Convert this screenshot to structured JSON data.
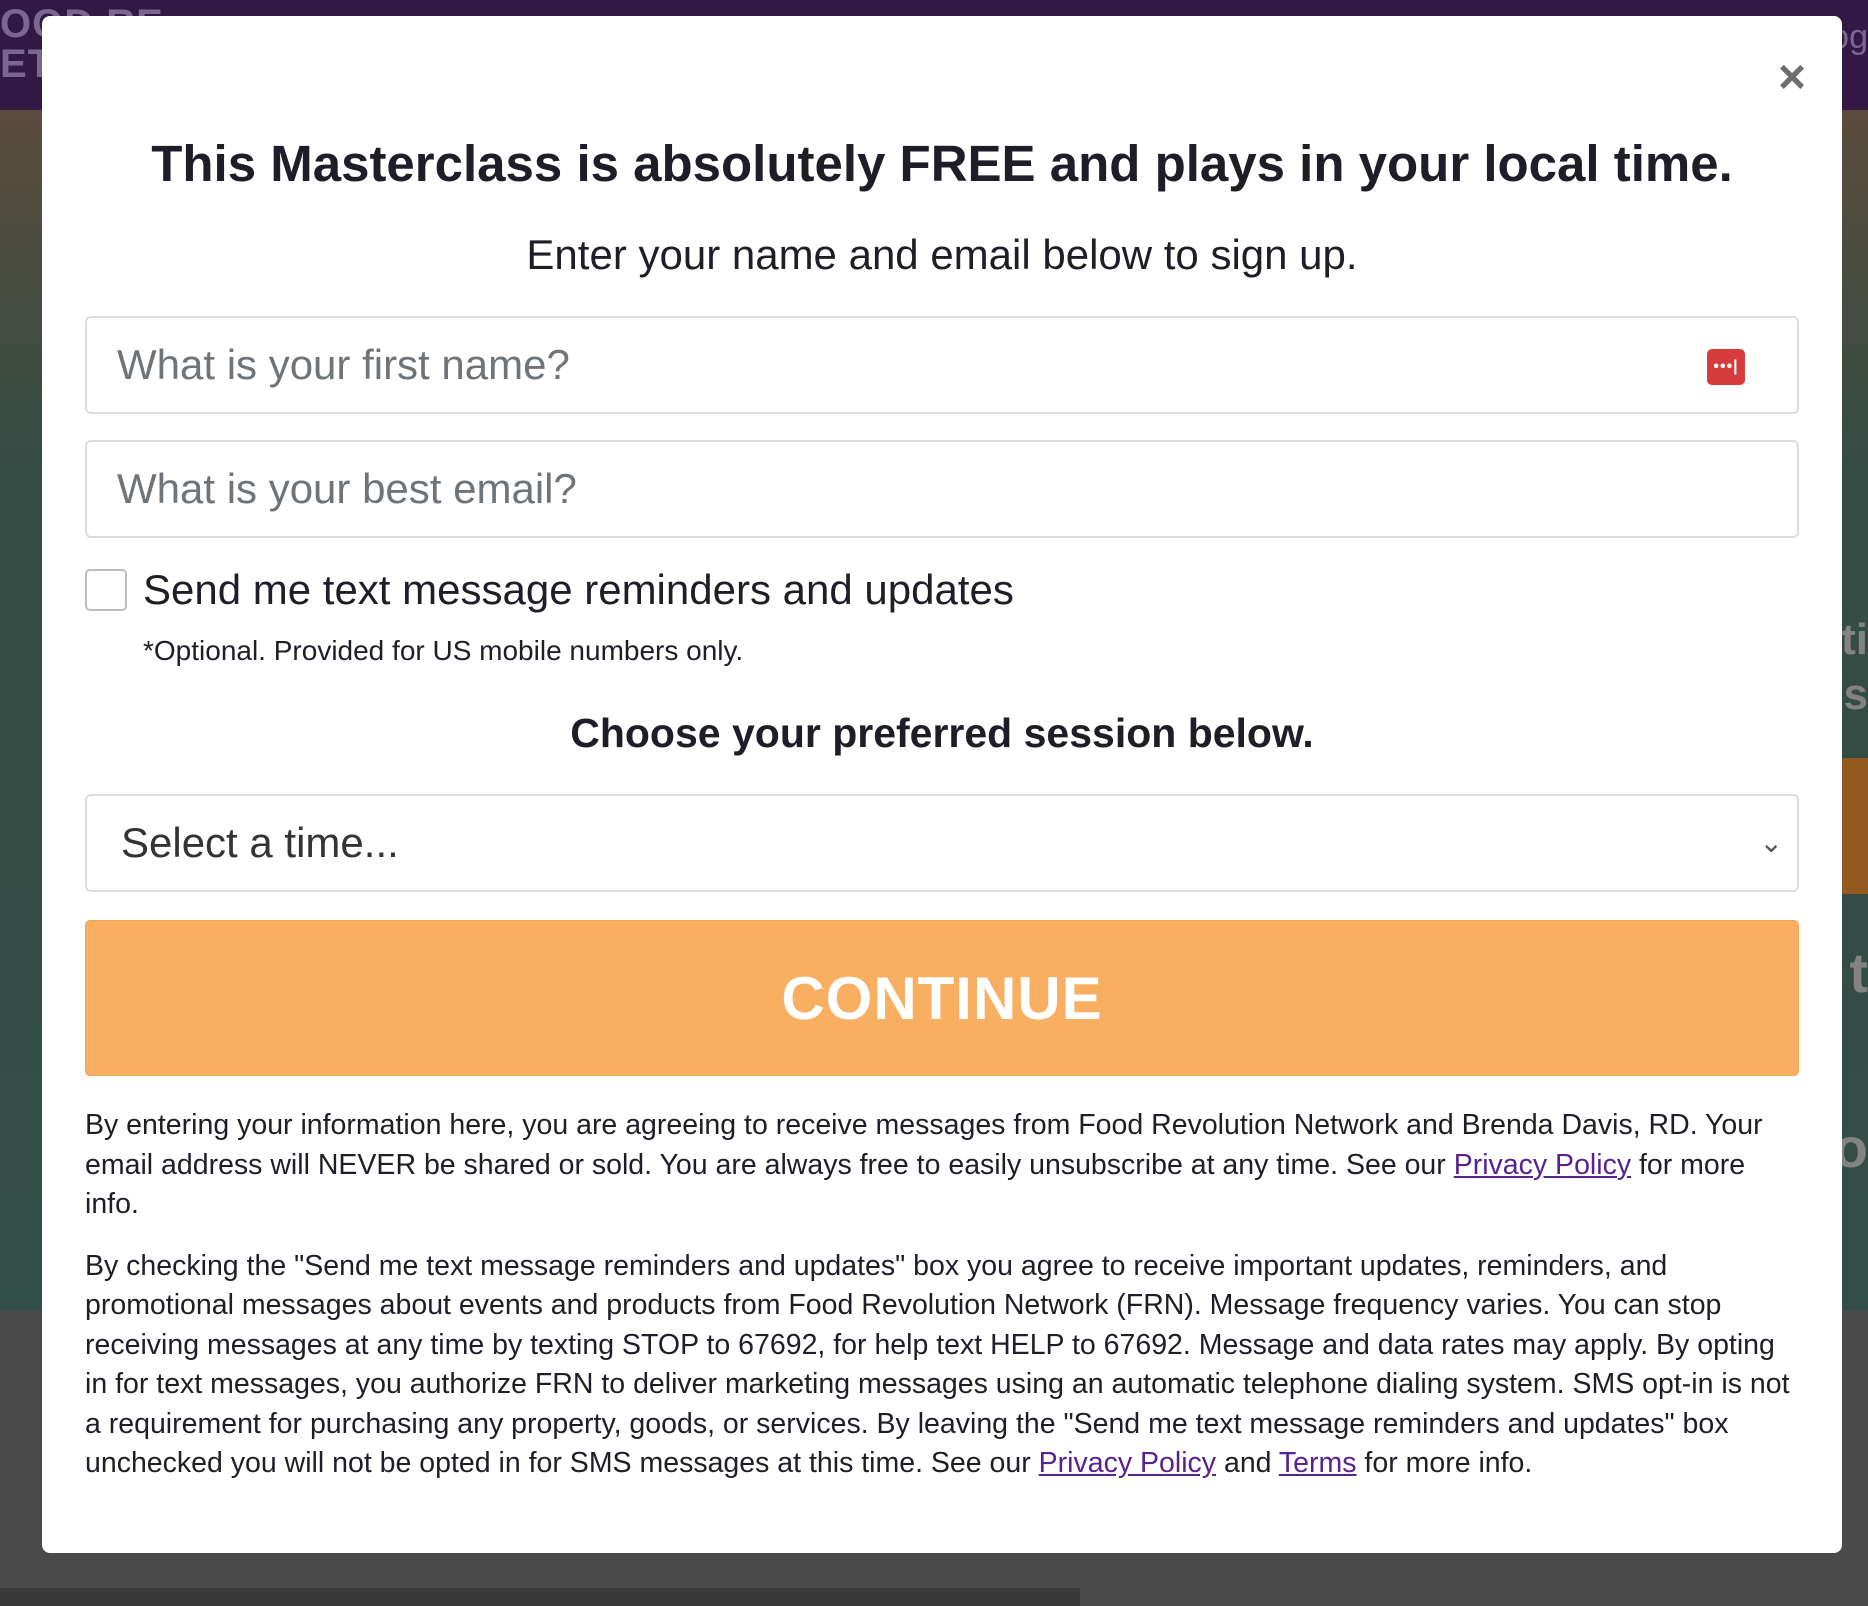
{
  "background": {
    "nav_logo": "OOD RE\nET",
    "nav_right": "og",
    "right_text_1": "ti",
    "right_text_2": "s",
    "right_text_3": "t",
    "right_text_4": "o"
  },
  "modal": {
    "close_label": "×",
    "title": "This Masterclass is absolutely FREE and plays in your local time.",
    "subtitle": "Enter your name and email below to sign up.",
    "first_name_placeholder": "What is your first name?",
    "email_placeholder": "What is your best email?",
    "password_manager_icon": "•••|",
    "sms_label": "Send me text message reminders and updates",
    "sms_note": "*Optional. Provided for US mobile numbers only.",
    "session_heading": "Choose your preferred session below.",
    "select_value": "Select a time...",
    "select_chevron": "⌄",
    "continue_label": "CONTINUE",
    "legal_1": {
      "text_before": "By entering your information here, you are agreeing to receive messages from Food Revolution Network and Brenda Davis, RD. Your email address will NEVER be shared or sold. You are always free to easily unsubscribe at any time. See our ",
      "privacy_link": "Privacy Policy",
      "text_after": " for more info."
    },
    "legal_2": {
      "text_before": "By checking the \"Send me text message reminders and updates\" box you agree to receive important updates, reminders, and promotional messages about events and products from Food Revolution Network (FRN). Message frequency varies. You can stop receiving messages at any time by texting STOP to 67692, for help text HELP to 67692. Message and data rates may apply. By opting in for text messages, you authorize FRN to deliver marketing messages using an automatic telephone dialing system. SMS opt-in is not a requirement for purchasing any property, goods, or services. By leaving the \"Send me text message reminders and updates\" box unchecked you will not be opted in for SMS messages at this time. See our ",
      "privacy_link": "Privacy Policy",
      "middle": " and ",
      "terms_link": "Terms",
      "text_after": " for more info."
    }
  },
  "colors": {
    "accent_button": "#f9af62",
    "link": "#5a2190",
    "nav_background": "#3a1d52",
    "password_icon": "#d63c3c"
  }
}
